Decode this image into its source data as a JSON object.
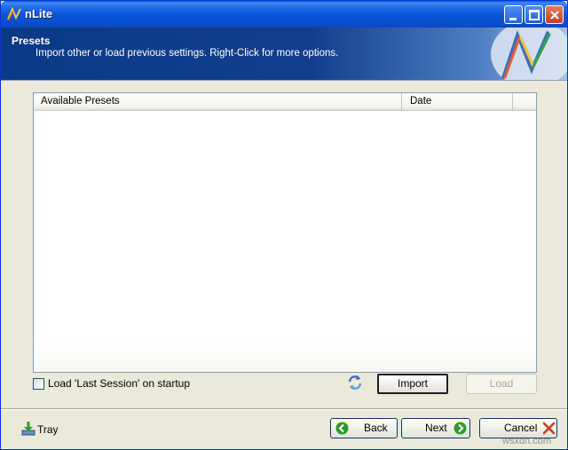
{
  "window": {
    "title": "nLite"
  },
  "banner": {
    "title": "Presets",
    "subtitle": "Import other or load previous settings. Right-Click for more options."
  },
  "list": {
    "columns": [
      "Available Presets",
      "Date"
    ],
    "rows": []
  },
  "options": {
    "load_last_session_label": "Load 'Last Session' on startup",
    "load_last_session_checked": false
  },
  "buttons": {
    "import": "Import",
    "load": "Load",
    "back": "Back",
    "next": "Next",
    "cancel": "Cancel",
    "tray": "Tray"
  },
  "watermark": "wsxdn.com",
  "icons": {
    "app": "nlite-logo-icon",
    "refresh": "refresh-icon",
    "tray": "tray-download-icon",
    "back": "back-arrow-icon",
    "next": "next-arrow-icon",
    "cancel": "cancel-x-icon"
  },
  "colors": {
    "titlebar": "#0a57d8",
    "banner": "#133e8c",
    "window_bg": "#ece9d8",
    "accent_green": "#2e9a2e",
    "close_red": "#c5401f"
  }
}
